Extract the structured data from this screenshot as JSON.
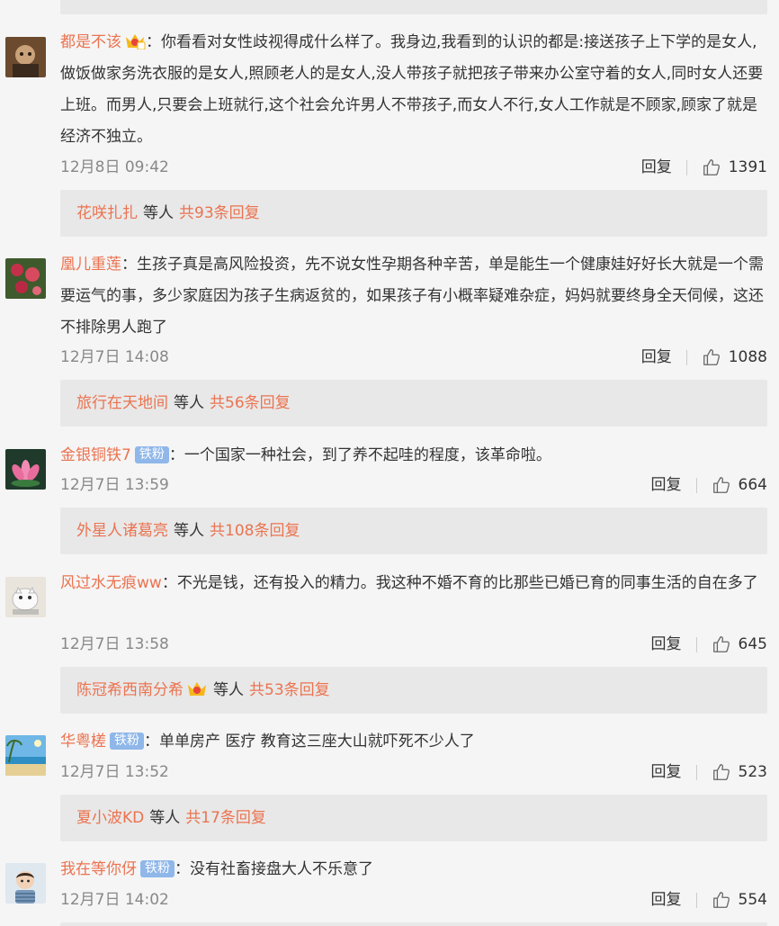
{
  "ui": {
    "reply_label": "回复",
    "etc_label": "等人"
  },
  "comments": [
    {
      "username": "都是不该",
      "has_crown": true,
      "badge": "",
      "text": "你看看对女性歧视得成什么样了。我身边,我看到的认识的都是:接送孩子上下学的是女人,做饭做家务洗衣服的是女人,照顾老人的是女人,没人带孩子就把孩子带来办公室守着的女人,同时女人还要上班。而男人,只要会上班就行,这个社会允许男人不带孩子,而女人不行,女人工作就是不顾家,顾家了就是经济不独立。",
      "time": "12月8日 09:42",
      "likes": "1391",
      "replies": {
        "first_replier": "花咲扎扎",
        "replier_crown": false,
        "total": "共93条回复"
      }
    },
    {
      "username": "凰儿重莲",
      "has_crown": false,
      "badge": "",
      "text": "生孩子真是高风险投资，先不说女性孕期各种辛苦，单是能生一个健康娃好好长大就是一个需要运气的事，多少家庭因为孩子生病返贫的，如果孩子有小概率疑难杂症，妈妈就要终身全天伺候，这还不排除男人跑了",
      "time": "12月7日 14:08",
      "likes": "1088",
      "replies": {
        "first_replier": "旅行在天地间",
        "replier_crown": false,
        "total": "共56条回复"
      }
    },
    {
      "username": "金银铜铁7",
      "has_crown": false,
      "badge": "铁粉",
      "text": "一个国家一种社会，到了养不起哇的程度，该革命啦。",
      "time": "12月7日 13:59",
      "likes": "664",
      "replies": {
        "first_replier": "外星人诸葛亮",
        "replier_crown": false,
        "total": "共108条回复"
      }
    },
    {
      "username": "风过水无痕ww",
      "has_crown": false,
      "badge": "",
      "text": "不光是钱，还有投入的精力。我这种不婚不育的比那些已婚已育的同事生活的自在多了",
      "time": "12月7日 13:58",
      "likes": "645",
      "replies": {
        "first_replier": "陈冠希西南分希",
        "replier_crown": true,
        "total": "共53条回复"
      }
    },
    {
      "username": "华粤槎",
      "has_crown": false,
      "badge": "铁粉",
      "text": "单单房产 医疗 教育这三座大山就吓死不少人了",
      "time": "12月7日 13:52",
      "likes": "523",
      "replies": {
        "first_replier": "夏小波KD",
        "replier_crown": false,
        "total": "共17条回复"
      }
    },
    {
      "username": "我在等你伢",
      "has_crown": false,
      "badge": "铁粉",
      "text": "没有社畜接盘大人不乐意了",
      "time": "12月7日 14:02",
      "likes": "554",
      "replies": null
    }
  ]
}
